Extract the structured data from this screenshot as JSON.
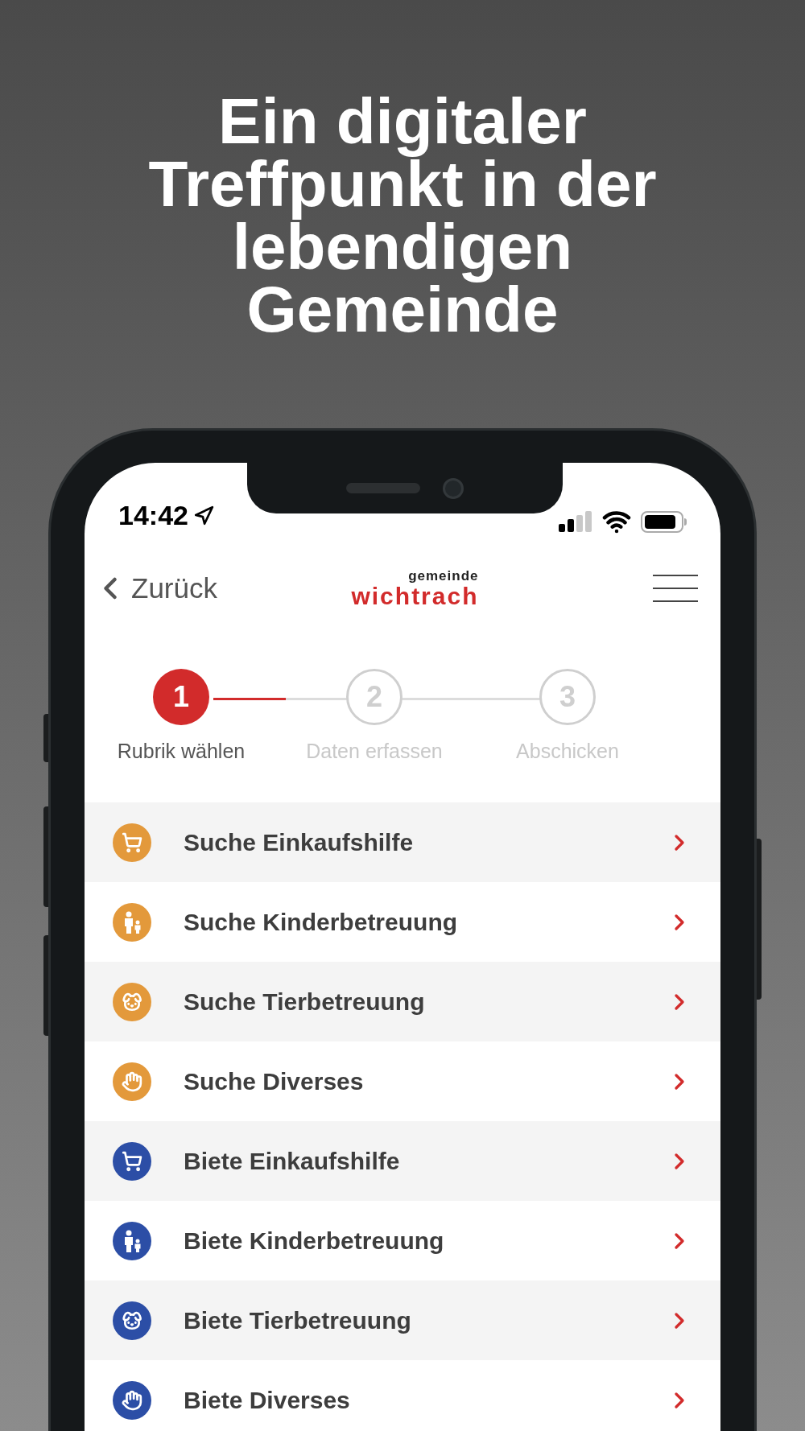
{
  "headline": "Ein digitaler Treffpunkt in der lebendigen Gemeinde",
  "status_bar": {
    "time": "14:42"
  },
  "nav": {
    "back": "Zurück",
    "logo_top": "gemeinde",
    "logo_main": "wichtrach"
  },
  "steps": [
    {
      "number": "1",
      "label": "Rubrik wählen",
      "active": true
    },
    {
      "number": "2",
      "label": "Daten erfassen",
      "active": false
    },
    {
      "number": "3",
      "label": "Abschicken",
      "active": false
    }
  ],
  "items": [
    {
      "label": "Suche Einkaufshilfe",
      "color": "#e3993b"
    },
    {
      "label": "Suche Kinderbetreuung",
      "color": "#e3993b"
    },
    {
      "label": "Suche Tierbetreuung",
      "color": "#e3993b"
    },
    {
      "label": "Suche Diverses",
      "color": "#e3993b"
    },
    {
      "label": "Biete Einkaufshilfe",
      "color": "#2c4ea6"
    },
    {
      "label": "Biete Kinderbetreuung",
      "color": "#2c4ea6"
    },
    {
      "label": "Biete Tierbetreuung",
      "color": "#2c4ea6"
    },
    {
      "label": "Biete Diverses",
      "color": "#2c4ea6"
    }
  ]
}
